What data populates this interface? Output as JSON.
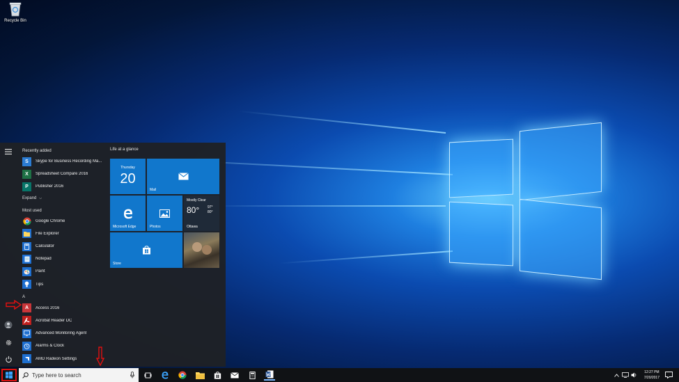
{
  "desktop": {
    "recycle_bin_label": "Recycle Bin"
  },
  "start_menu": {
    "recently_added_heading": "Recently added",
    "recently_added": [
      {
        "label": "Skype for Business Recording Ma...",
        "icon": "skype-recording-icon",
        "color": "#2b7cd3"
      },
      {
        "label": "Spreadsheet Compare 2016",
        "icon": "spreadsheet-compare-icon",
        "color": "#1e7145"
      },
      {
        "label": "Publisher 2016",
        "icon": "publisher-icon",
        "color": "#077568"
      }
    ],
    "expand_label": "Expand",
    "most_used_heading": "Most used",
    "most_used": [
      {
        "label": "Google Chrome",
        "icon": "chrome-icon",
        "color": "#2a2d33"
      },
      {
        "label": "File Explorer",
        "icon": "folder-icon",
        "color": "#1e6fd0"
      },
      {
        "label": "Calculator",
        "icon": "calculator-icon",
        "color": "#1e6fd0"
      },
      {
        "label": "Notepad",
        "icon": "notepad-icon",
        "color": "#1e6fd0"
      },
      {
        "label": "Paint",
        "icon": "paint-icon",
        "color": "#1e6fd0"
      },
      {
        "label": "Tips",
        "icon": "tips-icon",
        "color": "#1e6fd0"
      }
    ],
    "letter_a": "A",
    "letter_apps": [
      {
        "label": "Access 2016",
        "icon": "access-icon",
        "color": "#c9363a"
      },
      {
        "label": "Acrobat Reader DC",
        "icon": "acrobat-icon",
        "color": "#c0201e"
      },
      {
        "label": "Advanced Monitoring Agent",
        "icon": "monitoring-agent-icon",
        "color": "#1e6fd0"
      },
      {
        "label": "Alarms & Clock",
        "icon": "alarm-clock-icon",
        "color": "#1e6fd0"
      },
      {
        "label": "AMD Radeon Settings",
        "icon": "amd-icon",
        "color": "#1e6fd0"
      }
    ],
    "tiles_heading": "Life at a glance",
    "calendar_tile": {
      "day": "Thursday",
      "date": "20"
    },
    "mail_tile": {
      "label": "Mail"
    },
    "edge_tile": {
      "label": "Microsoft Edge"
    },
    "photos_tile": {
      "label": "Photos"
    },
    "weather_tile": {
      "condition": "Mostly Clear",
      "temp": "80°",
      "high": "97°",
      "low": "80°",
      "city": "Ottawa"
    },
    "store_tile": {
      "label": "Store"
    },
    "tile_color": "#1177cc"
  },
  "taskbar": {
    "search_placeholder": "Type here to search",
    "time": "12:27 PM",
    "date": "7/20/2017",
    "accent_color": "#e01010"
  }
}
